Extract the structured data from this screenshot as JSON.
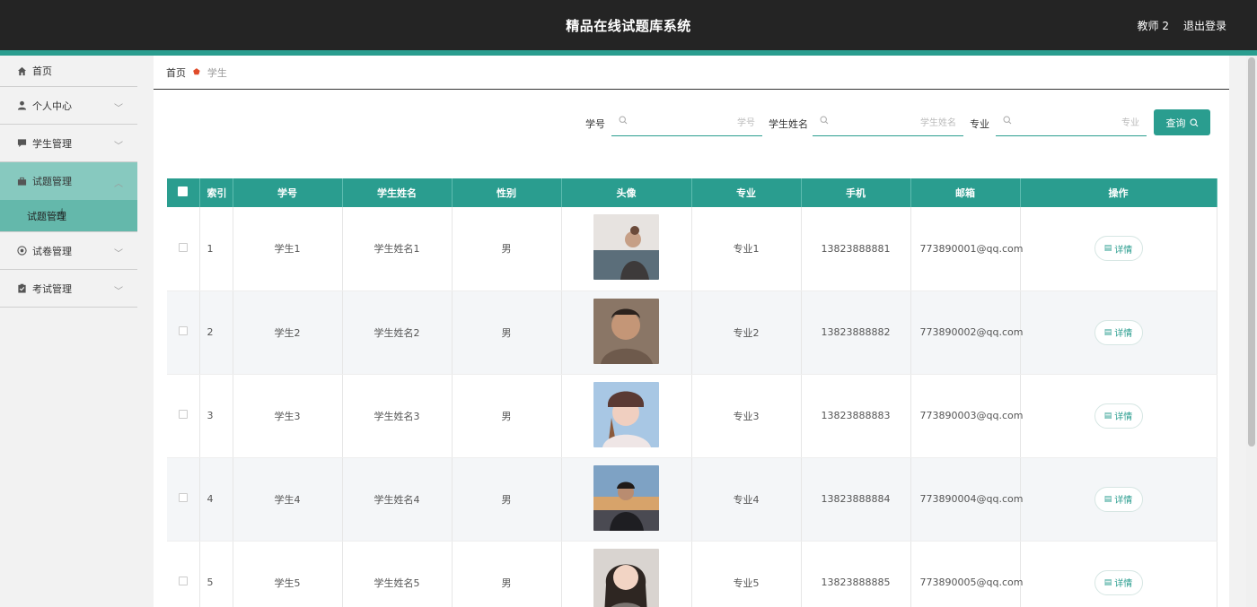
{
  "header": {
    "title": "精品在线试题库系统",
    "user": "教师 2",
    "logout": "退出登录"
  },
  "colors": {
    "accent": "#2a9d8f",
    "header_bg": "#242424",
    "sidebar_active": "#87c9bf",
    "sidebar_sub_active": "#64b8ab",
    "breadcrumb_sep": "#e04b2a"
  },
  "sidebar": {
    "items": [
      {
        "label": "首页",
        "icon": "home-icon"
      },
      {
        "label": "个人中心",
        "icon": "user-icon"
      },
      {
        "label": "学生管理",
        "icon": "chat-icon"
      },
      {
        "label": "试题管理",
        "icon": "briefcase-icon"
      },
      {
        "label": "试卷管理",
        "icon": "circle-icon"
      },
      {
        "label": "考试管理",
        "icon": "clipboard-icon"
      }
    ],
    "submenu_active": "试题管理"
  },
  "breadcrumb": {
    "home": "首页",
    "current": "学生"
  },
  "search": {
    "fields": [
      {
        "label": "学号",
        "placeholder": "学号",
        "value": ""
      },
      {
        "label": "学生姓名",
        "placeholder": "学生姓名",
        "value": ""
      },
      {
        "label": "专业",
        "placeholder": "专业",
        "value": ""
      }
    ],
    "button": "查询"
  },
  "table": {
    "headers": [
      "索引",
      "学号",
      "学生姓名",
      "性别",
      "头像",
      "专业",
      "手机",
      "邮箱",
      "操作"
    ],
    "rows": [
      {
        "index": "1",
        "id": "学生1",
        "name": "学生姓名1",
        "gender": "男",
        "major": "专业1",
        "phone": "13823888881",
        "email": "773890001@qq.com",
        "action": "详情"
      },
      {
        "index": "2",
        "id": "学生2",
        "name": "学生姓名2",
        "gender": "男",
        "major": "专业2",
        "phone": "13823888882",
        "email": "773890002@qq.com",
        "action": "详情"
      },
      {
        "index": "3",
        "id": "学生3",
        "name": "学生姓名3",
        "gender": "男",
        "major": "专业3",
        "phone": "13823888883",
        "email": "773890003@qq.com",
        "action": "详情"
      },
      {
        "index": "4",
        "id": "学生4",
        "name": "学生姓名4",
        "gender": "男",
        "major": "专业4",
        "phone": "13823888884",
        "email": "773890004@qq.com",
        "action": "详情"
      },
      {
        "index": "5",
        "id": "学生5",
        "name": "学生姓名5",
        "gender": "男",
        "major": "专业5",
        "phone": "13823888885",
        "email": "773890005@qq.com",
        "action": "详情"
      }
    ]
  }
}
